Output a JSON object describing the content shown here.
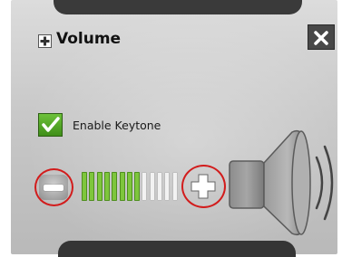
{
  "dialog": {
    "title": "Volume",
    "title_icon": "plus-square-icon",
    "close_icon": "close-icon"
  },
  "keytone": {
    "label": "Enable Keytone",
    "checked": true,
    "icon": "checkmark-icon"
  },
  "volume": {
    "decrease_icon": "minus-icon",
    "increase_icon": "plus-icon",
    "level": 8,
    "max_level": 13,
    "active_color": "#7ec63c",
    "inactive_color": "#f2f2f2"
  },
  "speaker": {
    "icon": "speaker-icon"
  },
  "colors": {
    "panel": "#c8c8c8",
    "tab": "#3a3a3a",
    "highlight": "#d21c1c"
  }
}
